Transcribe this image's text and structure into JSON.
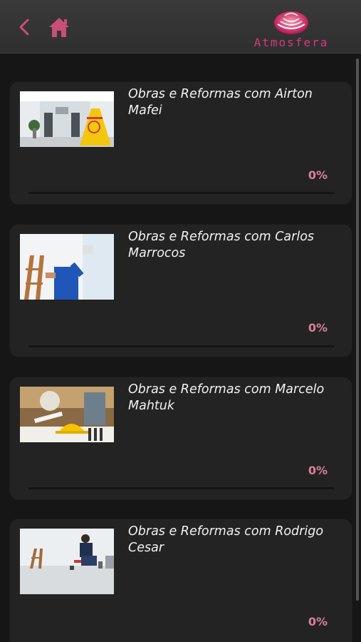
{
  "header": {
    "logo_text": "Atmosfera",
    "back_icon": "chevron-left-icon",
    "home_icon": "home-icon",
    "accent_color": "#c94f78"
  },
  "courses": [
    {
      "title": "Obras e Reformas com Airton Mafei",
      "progress_label": "0%",
      "progress": 0
    },
    {
      "title": "Obras e Reformas com Carlos Marrocos",
      "progress_label": "0%",
      "progress": 0
    },
    {
      "title": "Obras e Reformas com Marcelo Mahtuk",
      "progress_label": "0%",
      "progress": 0
    },
    {
      "title": "Obras e Reformas com Rodrigo Cesar",
      "progress_label": "0%",
      "progress": 0
    }
  ]
}
